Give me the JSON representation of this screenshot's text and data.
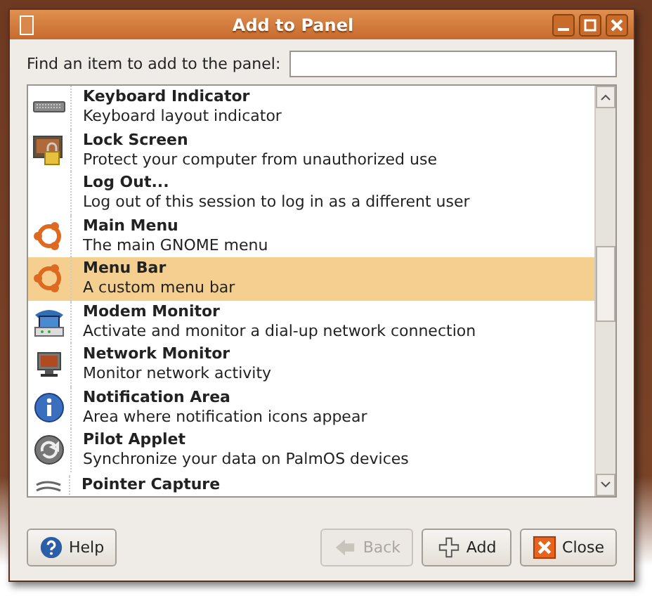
{
  "window": {
    "title": "Add to Panel"
  },
  "search": {
    "label": "Find an item to add to the panel:"
  },
  "items": [
    {
      "title": "Keyboard Indicator",
      "description": "Keyboard layout indicator",
      "selected": false
    },
    {
      "title": "Lock Screen",
      "description": "Protect your computer from unauthorized use",
      "selected": false
    },
    {
      "title": "Log Out...",
      "description": "Log out of this session to log in as a different user",
      "selected": false
    },
    {
      "title": "Main Menu",
      "description": "The main GNOME menu",
      "selected": false
    },
    {
      "title": "Menu Bar",
      "description": "A custom menu bar",
      "selected": true
    },
    {
      "title": "Modem Monitor",
      "description": "Activate and monitor a dial-up network connection",
      "selected": false
    },
    {
      "title": "Network Monitor",
      "description": "Monitor network activity",
      "selected": false
    },
    {
      "title": "Notification Area",
      "description": "Area where notification icons appear",
      "selected": false
    },
    {
      "title": "Pilot Applet",
      "description": "Synchronize your data on PalmOS devices",
      "selected": false
    },
    {
      "title": "Pointer Capture",
      "selected": false
    }
  ],
  "buttons": [
    {
      "label": "Help",
      "kind": "help",
      "disabled": false
    },
    {
      "label": "Back",
      "kind": "back",
      "disabled": true
    },
    {
      "label": "Add",
      "kind": "add",
      "disabled": false
    },
    {
      "label": "Close",
      "kind": "close",
      "disabled": false
    }
  ]
}
